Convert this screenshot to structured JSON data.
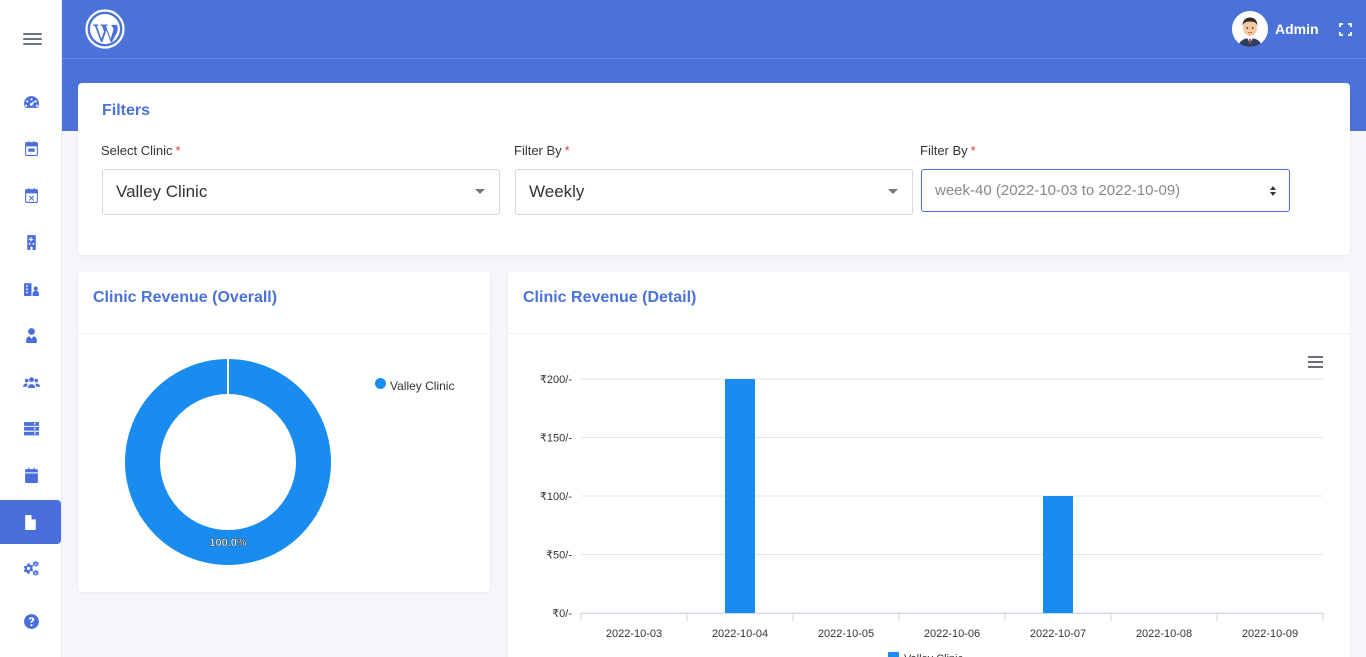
{
  "header": {
    "user_name": "Admin",
    "icons": [
      "menu-icon",
      "wordpress-logo",
      "avatar",
      "fullscreen-icon"
    ]
  },
  "sidebar": {
    "items": [
      {
        "icon": "dashboard-icon"
      },
      {
        "icon": "calendar-icon"
      },
      {
        "icon": "calendar-cancel-icon"
      },
      {
        "icon": "hospital-icon"
      },
      {
        "icon": "clinic-admin-icon"
      },
      {
        "icon": "doctor-icon"
      },
      {
        "icon": "patients-icon"
      },
      {
        "icon": "services-icon"
      },
      {
        "icon": "holiday-calendar-icon"
      },
      {
        "icon": "reports-icon",
        "active": true
      },
      {
        "icon": "settings-icon"
      },
      {
        "icon": "help-icon"
      }
    ]
  },
  "filters": {
    "title": "Filters",
    "clinic_label": "Select Clinic",
    "clinic_value": "Valley Clinic",
    "filter_by_label": "Filter By",
    "filter_by_value": "Weekly",
    "filter_by2_label": "Filter By",
    "week_value": "week-40 (2022-10-03 to 2022-10-09)",
    "required_mark": "*"
  },
  "overall": {
    "title": "Clinic Revenue (Overall)",
    "legend": "Valley Clinic",
    "percent_label": "100.0%"
  },
  "detail": {
    "title": "Clinic Revenue (Detail)",
    "legend": "Valley Clinic"
  },
  "colors": {
    "primary": "#4a72d9",
    "series": "#1a8cf0",
    "required": "#e53935"
  },
  "chart_data": [
    {
      "type": "pie",
      "title": "Clinic Revenue (Overall)",
      "categories": [
        "Valley Clinic"
      ],
      "values": [
        100
      ],
      "labels": [
        "100.0%"
      ],
      "legend": "top-right"
    },
    {
      "type": "bar",
      "title": "Clinic Revenue (Detail)",
      "categories": [
        "2022-10-03",
        "2022-10-04",
        "2022-10-05",
        "2022-10-06",
        "2022-10-07",
        "2022-10-08",
        "2022-10-09"
      ],
      "series": [
        {
          "name": "Valley Clinic",
          "values": [
            0,
            200,
            0,
            0,
            100,
            0,
            0
          ]
        }
      ],
      "yticks": [
        "₹0/-",
        "₹50/-",
        "₹100/-",
        "₹150/-",
        "₹200/-"
      ],
      "ylim": [
        0,
        200
      ],
      "grid": true,
      "legend": "bottom"
    }
  ]
}
